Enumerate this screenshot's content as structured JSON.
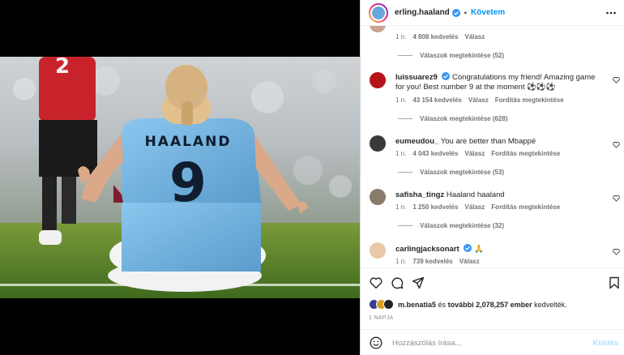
{
  "post": {
    "author": "erling.haaland",
    "follow_label": "Követem",
    "separator": "•",
    "jersey_name": "HAALAND",
    "jersey_number": "9"
  },
  "comments": [
    {
      "username": "",
      "text": "",
      "time": "1 n.",
      "likes": "4 808 kedvelés",
      "reply_label": "Válasz",
      "translate_label": "",
      "replies_label": "Válaszok megtekintése (52)",
      "avatar_color": "#c9a48c"
    },
    {
      "username": "luissuarez9",
      "text": "Congratulations my friend! Amazing game for you! Best number 9 at the moment ⚽⚽⚽",
      "time": "1 n.",
      "likes": "43 154 kedvelés",
      "reply_label": "Válasz",
      "translate_label": "Fordítás megtekintése",
      "replies_label": "Válaszok megtekintése (628)",
      "avatar_color": "#b5141b"
    },
    {
      "username": "eumeudou_",
      "text": "You are better than Mbappé",
      "time": "1 n.",
      "likes": "4 043 kedvelés",
      "reply_label": "Válasz",
      "translate_label": "Fordítás megtekintése",
      "replies_label": "Válaszok megtekintése (53)",
      "avatar_color": "#3a3a3a"
    },
    {
      "username": "safisha_tingz",
      "text": "Haaland haaland",
      "time": "1 n.",
      "likes": "1 250 kedvelés",
      "reply_label": "Válasz",
      "translate_label": "Fordítás megtekintése",
      "replies_label": "Válaszok megtekintése (32)",
      "avatar_color": "#8a7a6a"
    },
    {
      "username": "carlingjacksonart",
      "text": "🙏",
      "time": "1 n.",
      "likes": "739 kedvelés",
      "reply_label": "Válasz",
      "translate_label": "",
      "replies_label": "",
      "avatar_color": "#e8c8a8"
    }
  ],
  "likes": {
    "first_liker": "m.benatia5",
    "connector": "és",
    "others_label": "további 2,078,257 ember",
    "suffix": "kedvelték.",
    "avatar_colors": [
      "#3b3b8f",
      "#d9a020",
      "#222222"
    ]
  },
  "timestamp": "1 NAPJA",
  "composer": {
    "placeholder": "Hozzászólás írása...",
    "post_label": "Küldés"
  },
  "colors": {
    "accent": "#0095f6",
    "verified": "#3897f0",
    "jersey": "#7ab8e6"
  },
  "icons": [
    "verified-badge-icon",
    "more-options-icon",
    "heart-icon",
    "comment-icon",
    "share-icon",
    "bookmark-icon",
    "emoji-icon"
  ]
}
